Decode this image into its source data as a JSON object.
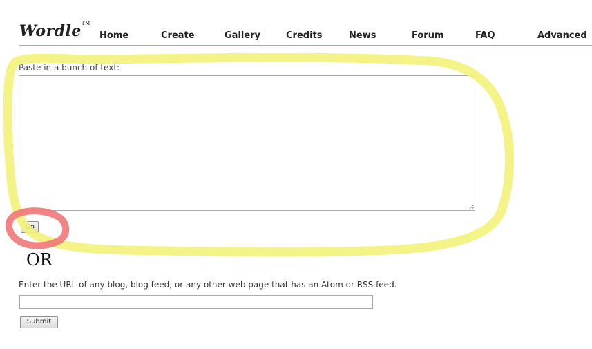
{
  "brand": {
    "name": "Wordle",
    "trademark": "TM"
  },
  "nav": {
    "items": [
      "Home",
      "Create",
      "Gallery",
      "Credits",
      "News",
      "Forum",
      "FAQ",
      "Advanced"
    ]
  },
  "paste": {
    "label": "Paste in a bunch of text:",
    "textarea_value": "",
    "go_label": "Go"
  },
  "or_text": "OR",
  "url": {
    "label": "Enter the URL of any blog, blog feed, or any other web page that has an Atom or RSS feed.",
    "input_value": "",
    "submit_label": "Submit"
  },
  "colors": {
    "highlight_yellow": "#f2f27a",
    "highlight_red": "#f07878",
    "nav_line": "#aaaaaa"
  }
}
